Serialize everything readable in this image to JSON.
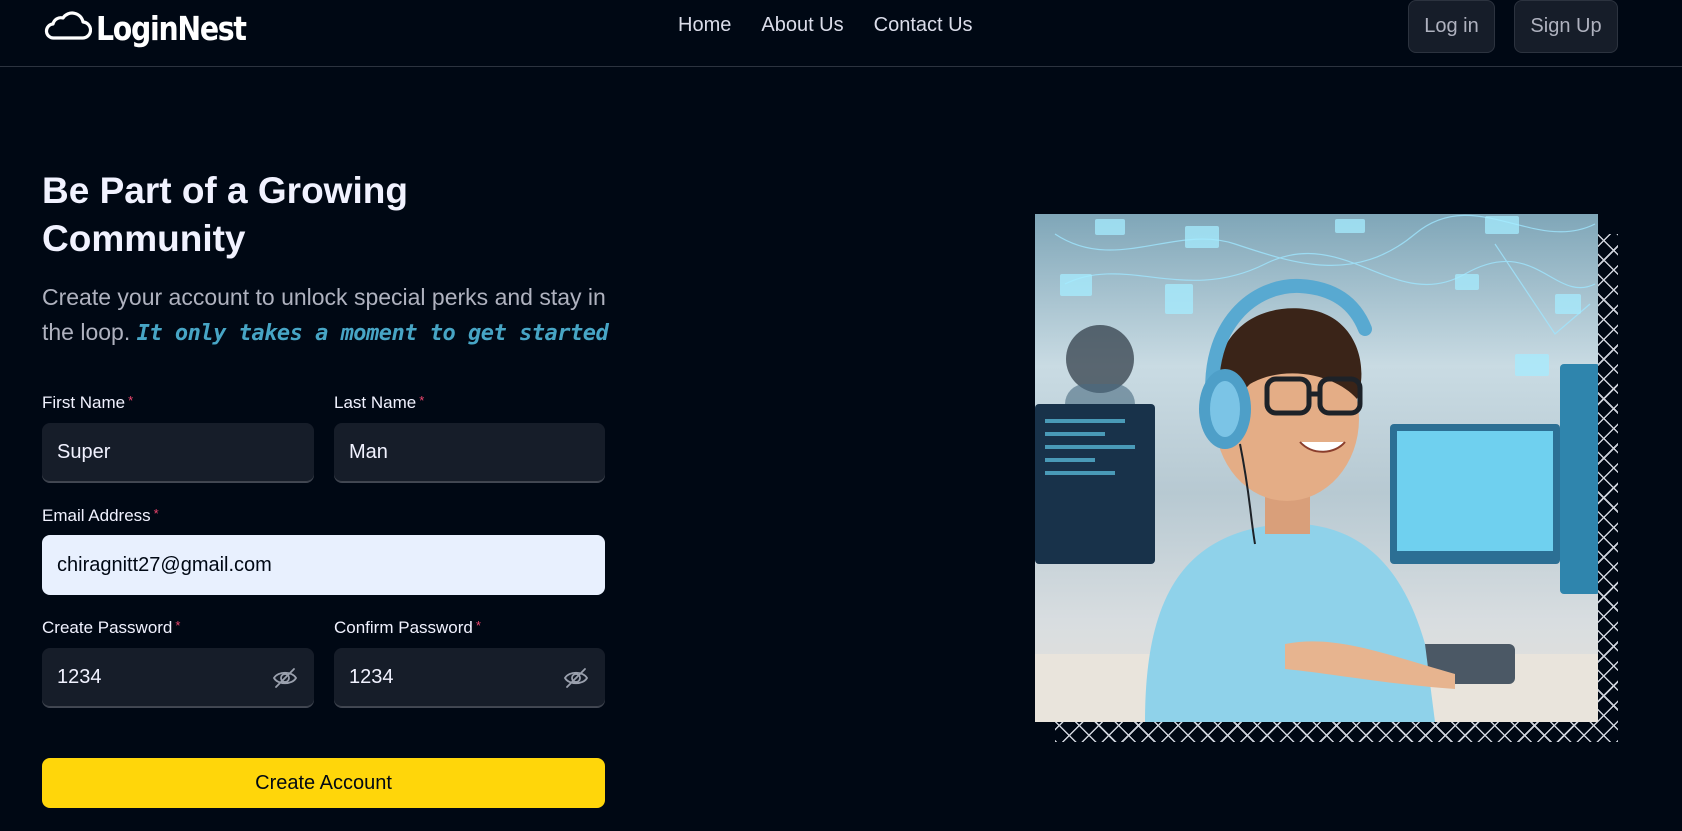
{
  "brand": {
    "name": "LoginNest",
    "icon": "cloud-icon"
  },
  "nav": {
    "links": [
      {
        "label": "Home"
      },
      {
        "label": "About Us"
      },
      {
        "label": "Contact Us"
      }
    ],
    "login_label": "Log in",
    "signup_label": "Sign Up"
  },
  "hero": {
    "title": "Be Part of a Growing Community",
    "subtitle": "Create your account to unlock special perks and stay in the loop.",
    "highlight": "It only takes a moment to get started"
  },
  "form": {
    "first_name": {
      "label": "First Name",
      "value": "Super"
    },
    "last_name": {
      "label": "Last Name",
      "value": "Man"
    },
    "email": {
      "label": "Email Address",
      "value": "chiragnitt27@gmail.com"
    },
    "password": {
      "label": "Create Password",
      "value": "1234",
      "toggle_icon": "eye-off-icon"
    },
    "confirm_password": {
      "label": "Confirm Password",
      "value": "1234",
      "toggle_icon": "eye-off-icon"
    },
    "required_mark": "*",
    "submit_label": "Create Account"
  },
  "colors": {
    "background": "#000814",
    "accent_yellow": "#ffd60a",
    "highlight_blue": "#47a5c5",
    "required_red": "#ef476f",
    "input_bg": "#161d29"
  }
}
